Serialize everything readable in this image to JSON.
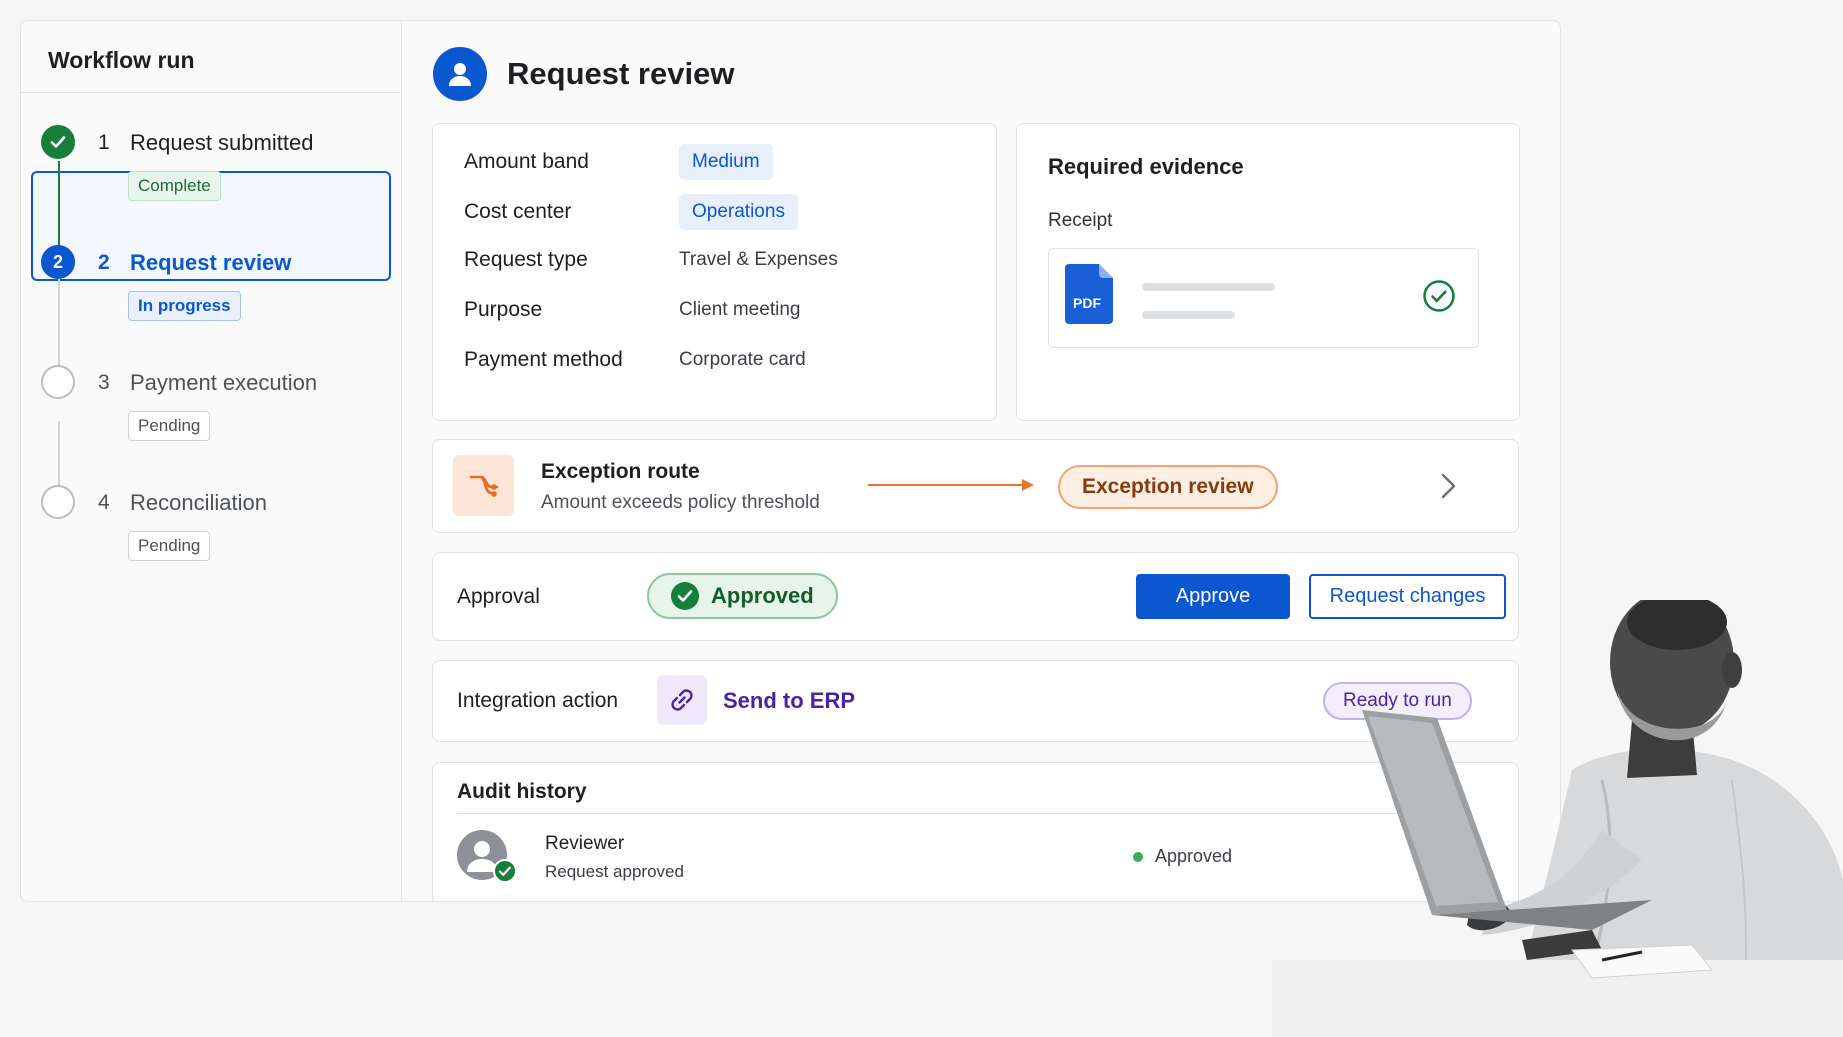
{
  "sidebar": {
    "title": "Workflow run",
    "steps": [
      {
        "number": "1",
        "label": "Request submitted",
        "status": "Complete"
      },
      {
        "number": "2",
        "label": "Request review",
        "status": "In progress"
      },
      {
        "number": "3",
        "label": "Payment execution",
        "status": "Pending"
      },
      {
        "number": "4",
        "label": "Reconciliation",
        "status": "Pending"
      }
    ]
  },
  "header": {
    "title": "Request review",
    "icon": "user-icon"
  },
  "details": {
    "amount_band": {
      "key": "Amount band",
      "value": "Medium"
    },
    "cost_center": {
      "key": "Cost center",
      "value": "Operations"
    },
    "request_type": {
      "key": "Request type",
      "value": "Travel & Expenses"
    },
    "purpose": {
      "key": "Purpose",
      "value": "Client meeting"
    },
    "payment_method": {
      "key": "Payment method",
      "value": "Corporate card"
    }
  },
  "evidence": {
    "title": "Required evidence",
    "subtitle": "Receipt",
    "file_type": "PDF",
    "verified_icon": "check-circle-icon"
  },
  "exception": {
    "title": "Exception route",
    "subtitle": "Amount exceeds policy threshold",
    "destination": "Exception review",
    "icon": "branch-icon"
  },
  "approval": {
    "label": "Approval",
    "status": "Approved",
    "approve_label": "Approve",
    "changes_label": "Request changes"
  },
  "integration": {
    "label": "Integration action",
    "action": "Send to ERP",
    "status": "Ready to run",
    "icon": "link-icon"
  },
  "audit": {
    "title": "Audit history",
    "entries": [
      {
        "actor": "Reviewer",
        "description": "Request approved",
        "status": "Approved"
      }
    ]
  },
  "colors": {
    "primary": "#0b57d0",
    "success": "#16803b",
    "warning": "#f3a475",
    "integration": "#4a22a8"
  }
}
